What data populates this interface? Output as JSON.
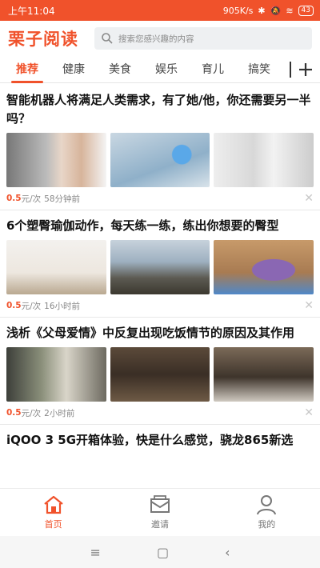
{
  "status": {
    "time": "上午11:04",
    "speed": "905K/s",
    "battery": "43"
  },
  "header": {
    "logo": "栗子阅读",
    "search_placeholder": "搜索您感兴趣的内容"
  },
  "tabs": [
    {
      "label": "推荐",
      "active": true
    },
    {
      "label": "健康"
    },
    {
      "label": "美食"
    },
    {
      "label": "娱乐"
    },
    {
      "label": "育儿"
    },
    {
      "label": "搞笑"
    }
  ],
  "articles": [
    {
      "title": "智能机器人将满足人类需求，有了她/他，你还需要另一半吗？",
      "price": "0.5",
      "unit": "元/次",
      "time": "58分钟前"
    },
    {
      "title": "6个塑臀瑜伽动作，每天练一练，练出你想要的臀型",
      "price": "0.5",
      "unit": "元/次",
      "time": "16小时前"
    },
    {
      "title": "浅析《父母爱情》中反复出现吃饭情节的原因及其作用",
      "price": "0.5",
      "unit": "元/次",
      "time": "2小时前"
    },
    {
      "title": "iQOO 3 5G开箱体验，快是什么感觉，骁龙865新选"
    }
  ],
  "bottom_nav": [
    {
      "label": "首页",
      "icon": "home-icon",
      "active": true
    },
    {
      "label": "邀请",
      "icon": "mail-icon"
    },
    {
      "label": "我的",
      "icon": "user-icon"
    }
  ],
  "colors": {
    "accent": "#f0522b"
  }
}
